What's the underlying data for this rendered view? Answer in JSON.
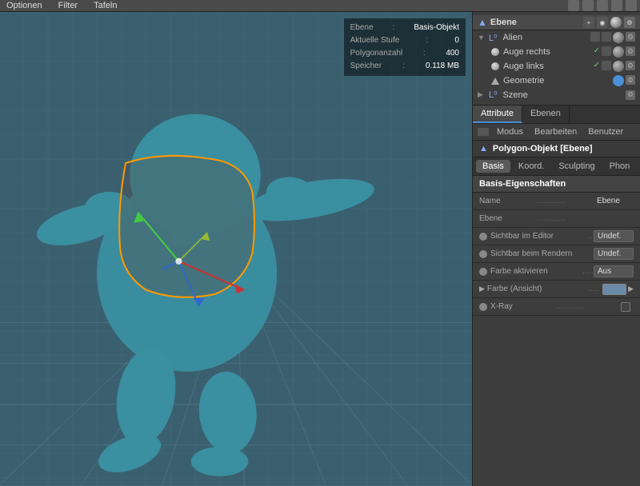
{
  "menubar": {
    "items": [
      "Optionen",
      "Filter",
      "Tafeln"
    ],
    "icons": [
      "move",
      "camera",
      "up",
      "down",
      "settings"
    ]
  },
  "viewport": {
    "info": {
      "ebene_label": "Ebene",
      "ebene_value": "Basis-Objekt",
      "stufe_label": "Aktuelle Stufe",
      "stufe_value": "0",
      "poly_label": "Polygonanzahl",
      "poly_value": "400",
      "speicher_label": "Speicher",
      "speicher_value": "0.118 MB"
    }
  },
  "scene_panel": {
    "title": "Ebene",
    "items": [
      {
        "label": "Alien",
        "type": "group",
        "indent": 0,
        "children": [
          {
            "label": "Auge rechts",
            "type": "sphere",
            "indent": 1
          },
          {
            "label": "Auge links",
            "type": "sphere",
            "indent": 1
          },
          {
            "label": "Geometrie",
            "type": "geometry",
            "indent": 1
          }
        ]
      },
      {
        "label": "Szene",
        "type": "scene",
        "indent": 0
      }
    ]
  },
  "attr_panel": {
    "tabs": [
      {
        "label": "Attribute",
        "active": true
      },
      {
        "label": "Ebenen",
        "active": false
      }
    ],
    "toolbar": {
      "items": [
        "Modus",
        "Bearbeiten",
        "Benutzer"
      ]
    },
    "object_title": "Polygon-Objekt [Ebene]",
    "prop_tabs": [
      {
        "label": "Basis",
        "active": true
      },
      {
        "label": "Koord.",
        "active": false
      },
      {
        "label": "Sculpting",
        "active": false
      },
      {
        "label": "Phon",
        "active": false
      }
    ],
    "section_title": "Basis-Eigenschaften",
    "properties": [
      {
        "label": "Name",
        "dots": true,
        "value": "Ebene",
        "type": "text",
        "bullet": false,
        "checkbox": false
      },
      {
        "label": "Ebene",
        "dots": true,
        "value": "",
        "type": "text",
        "bullet": false,
        "checkbox": false
      },
      {
        "label": "Sichtbar im Editor",
        "dots": true,
        "value": "Undef.",
        "type": "box",
        "bullet": true,
        "bullet_color": "gray",
        "checkbox": false
      },
      {
        "label": "Sichtbar beim Rendern",
        "dots": true,
        "value": "Undef.",
        "type": "box",
        "bullet": true,
        "bullet_color": "gray",
        "checkbox": false
      },
      {
        "label": "Farbe aktivieren",
        "dots": true,
        "value": "Aus",
        "type": "box",
        "bullet": true,
        "bullet_color": "gray",
        "checkbox": false
      },
      {
        "label": "Farbe (Ansicht)",
        "dots": true,
        "value": "",
        "type": "color",
        "bullet": false,
        "arrow": true,
        "checkbox": false
      },
      {
        "label": "X-Ray",
        "dots": true,
        "value": "",
        "type": "checkbox",
        "bullet": true,
        "bullet_color": "gray",
        "checkbox": true
      }
    ]
  }
}
